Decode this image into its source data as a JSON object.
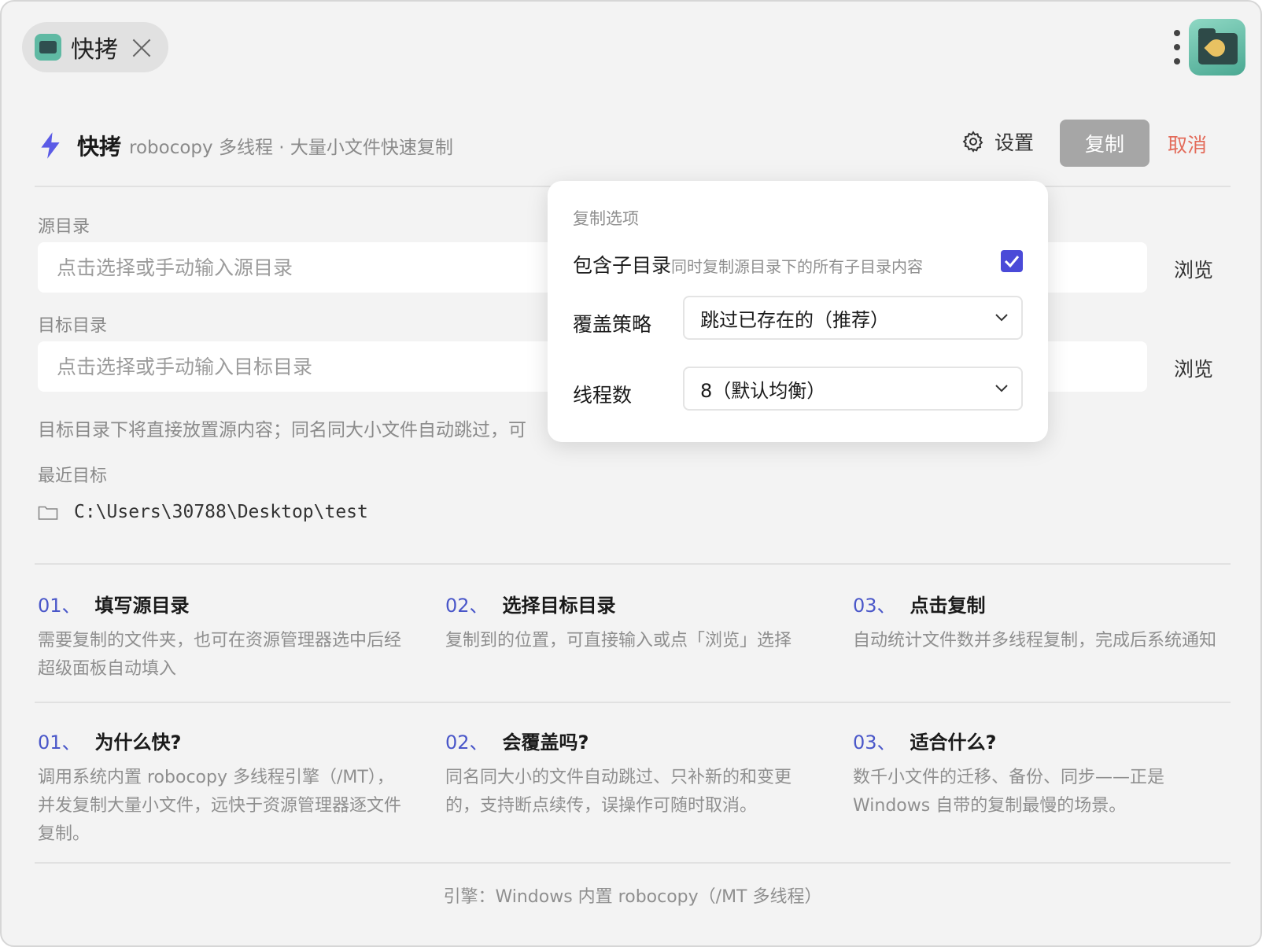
{
  "tab": {
    "title": "快拷",
    "icon": "folder-rocket-icon"
  },
  "header": {
    "title": "快拷",
    "subtitle": "robocopy 多线程 · 大量小文件快速复制",
    "settings_label": "设置",
    "copy_label": "复制",
    "cancel_label": "取消"
  },
  "source": {
    "label": "源目录",
    "placeholder": "点击选择或手动输入源目录",
    "browse_label": "浏览"
  },
  "target": {
    "label": "目标目录",
    "placeholder": "点击选择或手动输入目标目录",
    "browse_label": "浏览"
  },
  "hint": "目标目录下将直接放置源内容；同名同大小文件自动跳过，可",
  "recent": {
    "label": "最近目标",
    "items": [
      "C:\\Users\\30788\\Desktop\\test"
    ]
  },
  "steps": [
    {
      "num": "01、",
      "title": "填写源目录",
      "body": "需要复制的文件夹，也可在资源管理器选中后经超级面板自动填入"
    },
    {
      "num": "02、",
      "title": "选择目标目录",
      "body": "复制到的位置，可直接输入或点「浏览」选择"
    },
    {
      "num": "03、",
      "title": "点击复制",
      "body": "自动统计文件数并多线程复制，完成后系统通知"
    }
  ],
  "faq": [
    {
      "num": "01、",
      "title": "为什么快?",
      "body": "调用系统内置 robocopy 多线程引擎（/MT），并发复制大量小文件，远快于资源管理器逐文件复制。"
    },
    {
      "num": "02、",
      "title": "会覆盖吗?",
      "body": "同名同大小的文件自动跳过、只补新的和变更的，支持断点续传，误操作可随时取消。"
    },
    {
      "num": "03、",
      "title": "适合什么?",
      "body": "数千小文件的迁移、备份、同步——正是 Windows 自带的复制最慢的场景。"
    }
  ],
  "footer": "引擎：Windows 内置 robocopy（/MT 多线程）",
  "popover": {
    "title": "复制选项",
    "include_subdirs": {
      "label": "包含子目录",
      "desc": "同时复制源目录下的所有子目录内容",
      "checked": true
    },
    "overwrite": {
      "label": "覆盖策略",
      "value": "跳过已存在的（推荐）"
    },
    "threads": {
      "label": "线程数",
      "value": "8（默认均衡）"
    }
  },
  "colors": {
    "accent": "#4a57c9",
    "cancel": "#e36b5a",
    "checkbox": "#4a4ad8",
    "copy_button": "#a6a6a6"
  }
}
